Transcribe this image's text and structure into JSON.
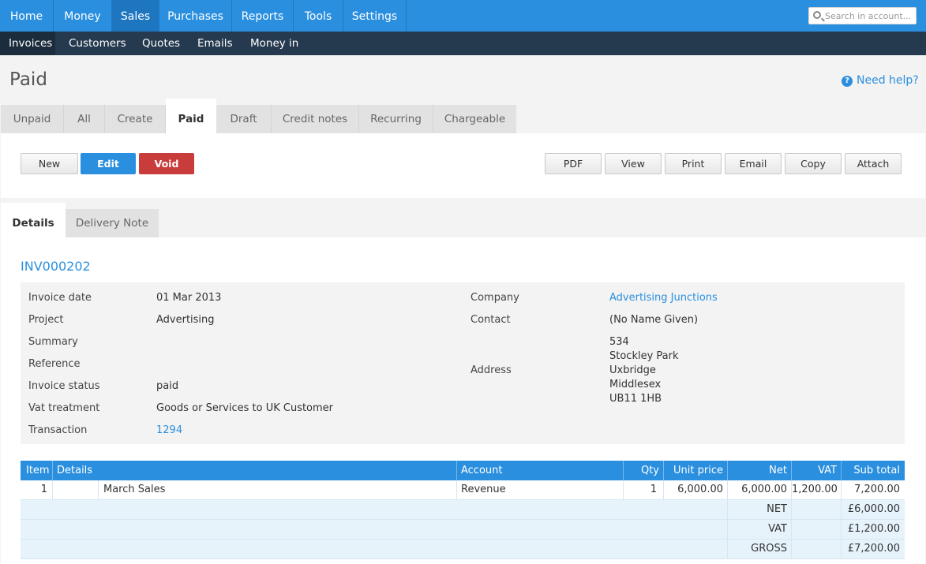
{
  "top_nav": {
    "items": [
      {
        "label": "Home"
      },
      {
        "label": "Money"
      },
      {
        "label": "Sales"
      },
      {
        "label": "Purchases"
      },
      {
        "label": "Reports"
      },
      {
        "label": "Tools"
      },
      {
        "label": "Settings"
      }
    ],
    "active": "Sales",
    "search_placeholder": "Search in account..."
  },
  "sub_nav": {
    "items": [
      {
        "label": "Invoices"
      },
      {
        "label": "Customers"
      },
      {
        "label": "Quotes"
      },
      {
        "label": "Emails"
      },
      {
        "label": "Money in"
      }
    ],
    "active": "Invoices"
  },
  "page": {
    "title": "Paid",
    "help": "Need help?",
    "help_icon": "question-circle-icon"
  },
  "tabs": [
    {
      "label": "Unpaid"
    },
    {
      "label": "All"
    },
    {
      "label": "Create"
    },
    {
      "label": "Paid"
    },
    {
      "label": "Draft"
    },
    {
      "label": "Credit notes"
    },
    {
      "label": "Recurring"
    },
    {
      "label": "Chargeable"
    }
  ],
  "actions": {
    "new": "New",
    "edit": "Edit",
    "void": "Void",
    "pdf": "PDF",
    "view": "View",
    "print": "Print",
    "email": "Email",
    "copy": "Copy",
    "attach": "Attach"
  },
  "detail_tabs": [
    {
      "label": "Details"
    },
    {
      "label": "Delivery Note"
    }
  ],
  "invoice": {
    "id": "INV000202",
    "fields": {
      "invoice_date": {
        "label": "Invoice date",
        "value": "01 Mar 2013"
      },
      "project": {
        "label": "Project",
        "value": "Advertising"
      },
      "summary": {
        "label": "Summary",
        "value": ""
      },
      "reference": {
        "label": "Reference",
        "value": ""
      },
      "status": {
        "label": "Invoice status",
        "value": "paid"
      },
      "vat_treatment": {
        "label": "Vat treatment",
        "value": "Goods or Services to UK Customer"
      },
      "transaction": {
        "label": "Transaction",
        "value": "1294"
      },
      "company": {
        "label": "Company",
        "value": "Advertising Junctions"
      },
      "contact": {
        "label": "Contact",
        "value": "(No Name Given)"
      },
      "address": {
        "label": "Address",
        "lines": [
          "534",
          "Stockley Park",
          "Uxbridge",
          "Middlesex",
          "UB11 1HB"
        ]
      }
    }
  },
  "table": {
    "headers": {
      "item": "Item",
      "details": "Details",
      "account": "Account",
      "qty": "Qty",
      "unit_price": "Unit price",
      "net": "Net",
      "vat": "VAT",
      "sub_total": "Sub total"
    },
    "rows": [
      {
        "item": "1",
        "details": "March Sales",
        "account": "Revenue",
        "qty": "1",
        "unit_price": "6,000.00",
        "net": "6,000.00",
        "vat": "1,200.00",
        "sub_total": "7,200.00"
      }
    ],
    "totals": [
      {
        "label": "NET",
        "value": "£6,000.00"
      },
      {
        "label": "VAT",
        "value": "£1,200.00"
      },
      {
        "label": "GROSS",
        "value": "£7,200.00"
      }
    ]
  },
  "colors": {
    "accent": "#2a8fdf",
    "subnav": "#253a4f",
    "void": "#c83c3c"
  }
}
